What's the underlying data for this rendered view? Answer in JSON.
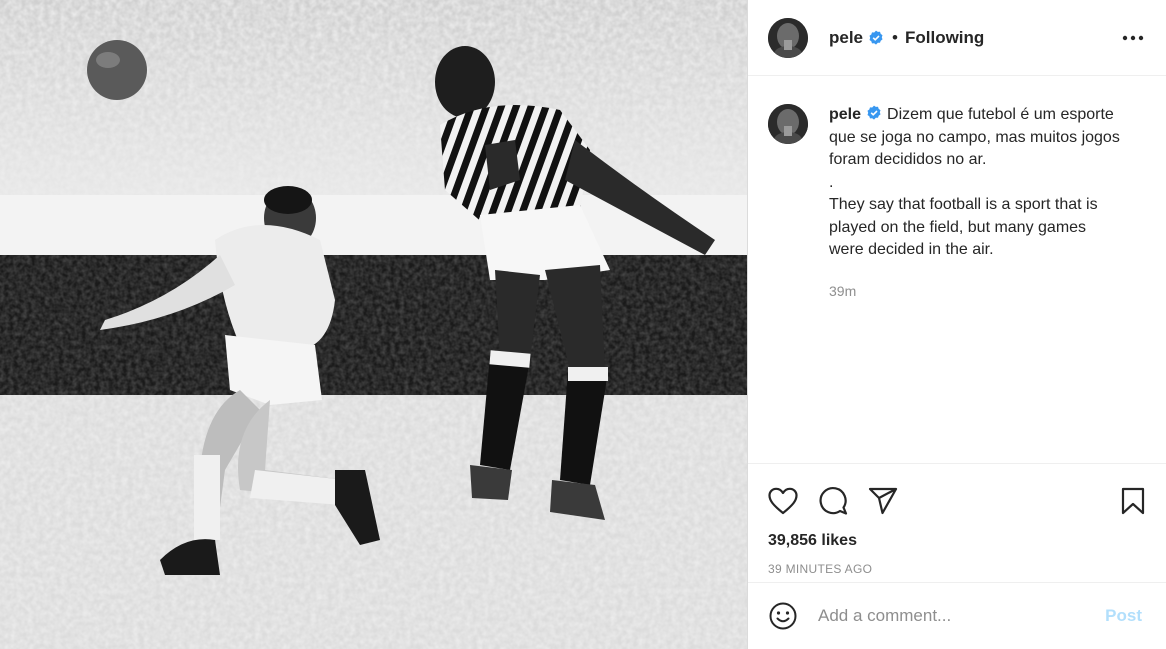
{
  "photo": {
    "alt_subject": "black-and-white football header photo"
  },
  "header": {
    "username": "pele",
    "separator": "•",
    "follow_state": "Following",
    "more_icon": "more-horizontal-icon"
  },
  "caption": {
    "username": "pele",
    "lines": [
      "Dizem que futebol é um esporte",
      "que se joga no campo, mas muitos jogos",
      "foram decididos no ar.",
      ".",
      "They say that football is a sport that is",
      "played on the field, but many games",
      "were decided in the air."
    ],
    "time": "39m"
  },
  "actions": {
    "like_icon": "heart-icon",
    "comment_icon": "comment-icon",
    "share_icon": "paper-plane-icon",
    "save_icon": "bookmark-icon"
  },
  "likes": "39,856 likes",
  "posted_ago": "39 MINUTES AGO",
  "comment": {
    "placeholder": "Add a comment...",
    "post_label": "Post",
    "emoji_icon": "smiley-icon"
  },
  "colors": {
    "verified_blue": "#3897f0",
    "post_disabled": "#b2dffc",
    "secondary_text": "#8e8e8e"
  }
}
